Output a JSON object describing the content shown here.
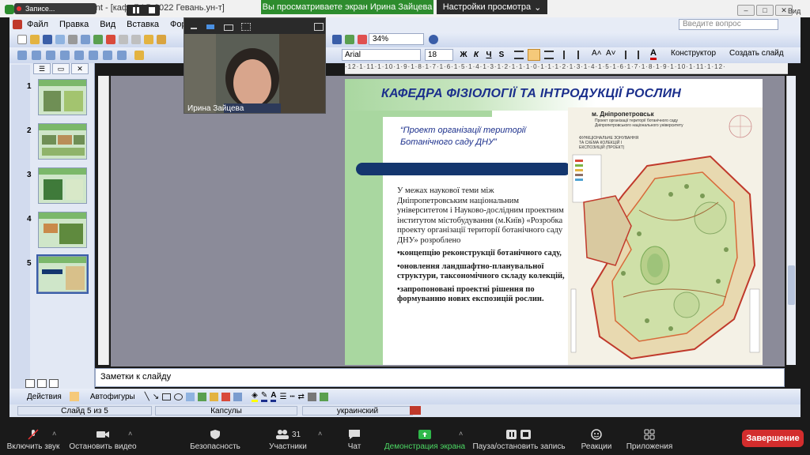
{
  "zoom_top": {
    "window_title": "Microsoft PowerPoint - [каф. БФР 2022 Гевань.ун-т]",
    "rec_label": "Записе...",
    "share_banner": "Вы просматриваете экран Ирина Зайцева",
    "view_settings": "Настройки просмотра",
    "view_label": "Вид"
  },
  "ppt": {
    "menu": [
      "Файл",
      "Правка",
      "Вид",
      "Вставка",
      "Формат"
    ],
    "help_placeholder": "Введите вопрос",
    "zoom_value": "34%",
    "font_name": "Arial",
    "font_size": "18",
    "fmt_buttons": [
      "Ж",
      "К",
      "Ч",
      "S"
    ],
    "designer_label": "Конструктор",
    "create_slide_label": "Создать слайд",
    "ruler_text": "·12·1·11·1·10·1·9·1·8·1·7·1·6·1·5·1·4·1·3·1·2·1·1·1·0·1·1·1·2·1·3·1·4·1·5·1·6·1·7·1·8·1·9·1·10·1·11·1·12·",
    "slide_numbers": [
      "1",
      "2",
      "3",
      "4",
      "5"
    ],
    "notes_placeholder": "Заметки к слайду",
    "draw_actions_label": "Действия",
    "draw_autoshapes_label": "Автофигуры",
    "status_slide": "Слайд 5 из 5",
    "status_theme": "Капсулы",
    "status_lang": "украинский"
  },
  "slide": {
    "title": "КАФЕДРА ФІЗІОЛОГІЇ ТА ІНТРОДУКЦІЇ РОСЛИН",
    "project_title": "“Проект організації території Ботанічного саду ДНУ”",
    "intro": "У межах наукової  теми між Дніпропетровським національним університетом і Науково-дослідним проектним інститутом містобудування (м.Київ) «Розробка проекту організації території ботанічного саду ДНУ» розроблено",
    "bullets": [
      "•концепцію реконструкції ботанічного саду,",
      "•оновлення ландшафтно-планувальної структури, таксономічного складу колекцій,",
      "•запропоновані проектні рішення по формуванню нових експозицій рослин."
    ],
    "map_city": "м. Дніпропетровськ",
    "map_caption": "Проект організації території ботанічного саду Дніпропетровського національного університету",
    "map_legend_title": "ФУНКЦІОНАЛЬНЕ ЗОНУВАННЯ ТА СХЕМА КОЛЕКЦІЙ І ЕКСПОЗИЦІЙ (ПРОЕКТ)"
  },
  "video": {
    "participant_name": "Ирина Зайцева"
  },
  "zoom_bottom": {
    "buttons": [
      {
        "label": "Включить звук"
      },
      {
        "label": "Остановить видео"
      },
      {
        "label": "Безопасность"
      },
      {
        "label": "Участники",
        "count": "31"
      },
      {
        "label": "Чат"
      },
      {
        "label": "Демонстрация экрана"
      },
      {
        "label": "Пауза/остановить запись"
      },
      {
        "label": "Реакции"
      },
      {
        "label": "Приложения"
      }
    ],
    "end_label": "Завершение"
  },
  "colors": {
    "share_green": "#2d8c2d",
    "slide_title_blue": "#1b2f8c",
    "bar_navy": "#14366e",
    "end_red": "#d32d2d"
  }
}
